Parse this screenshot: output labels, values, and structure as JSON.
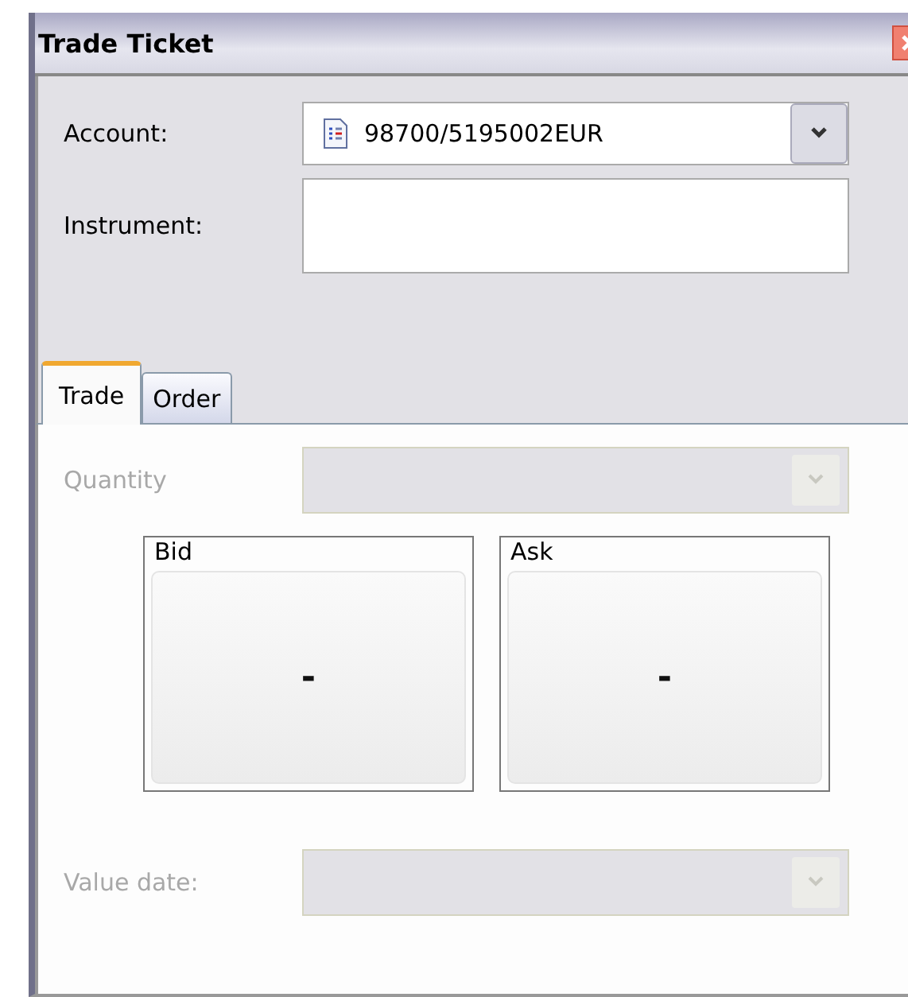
{
  "window": {
    "title": "Trade Ticket"
  },
  "account": {
    "label": "Account:",
    "value": "98700/5195002EUR"
  },
  "instrument": {
    "label": "Instrument:"
  },
  "tabs": [
    {
      "label": "Trade",
      "selected": true
    },
    {
      "label": "Order",
      "selected": false
    }
  ],
  "quantity": {
    "label": "Quantity",
    "disabled": true
  },
  "quotes": [
    {
      "label": "Bid",
      "price": "-"
    },
    {
      "label": "Ask",
      "price": "-"
    }
  ],
  "value_date": {
    "label": "Value date:",
    "disabled": true
  }
}
